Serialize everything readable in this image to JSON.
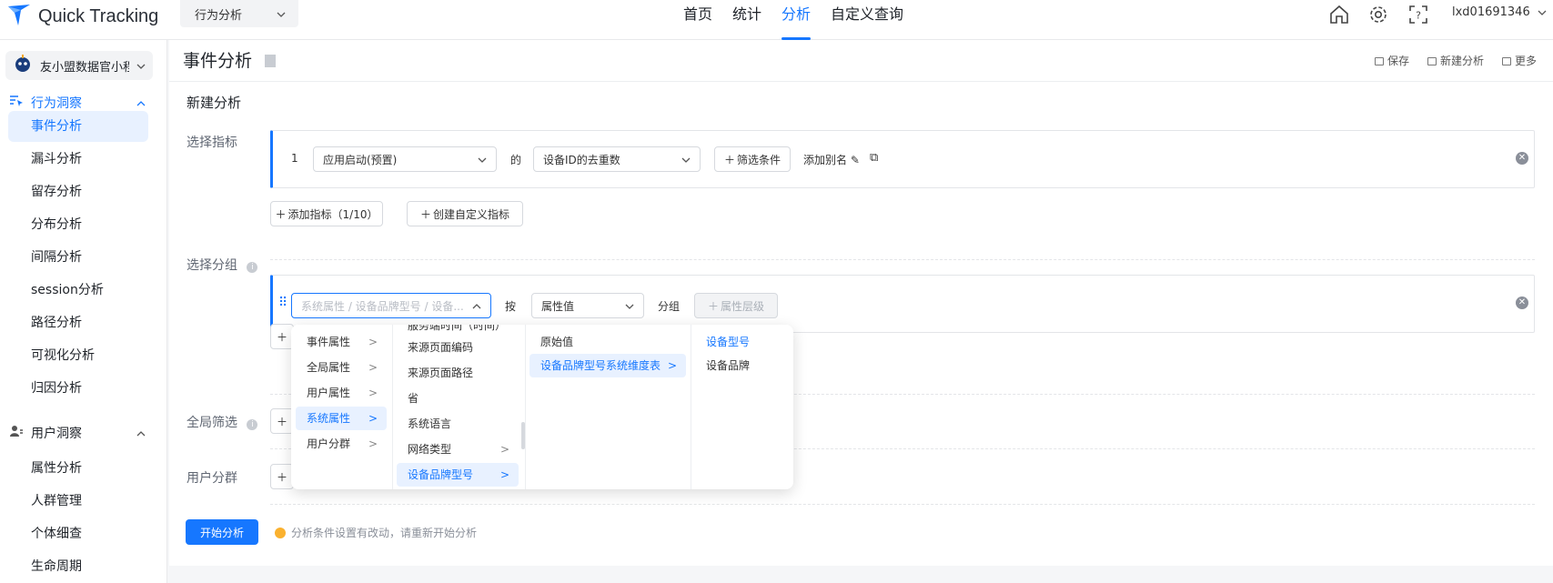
{
  "app": {
    "logo_text": "Quick Tracking",
    "module": "行为分析",
    "user": "lxd01691346",
    "brand_color": "#1677ff"
  },
  "nav": [
    {
      "label": "首页"
    },
    {
      "label": "统计"
    },
    {
      "label": "分析"
    },
    {
      "label": "自定义查询"
    }
  ],
  "sidebar": {
    "app_name": "友小盟数据官小程序",
    "group1": "行为洞察",
    "group1_items": [
      "事件分析",
      "漏斗分析",
      "留存分析",
      "分布分析",
      "间隔分析",
      "session分析",
      "路径分析",
      "可视化分析",
      "归因分析"
    ],
    "group2": "用户洞察",
    "group2_items": [
      "属性分析",
      "人群管理",
      "个体细查",
      "生命周期"
    ]
  },
  "page": {
    "title": "事件分析",
    "actions": [
      "保存",
      "新建分析",
      "更多"
    ],
    "section_title": "新建分析",
    "label_metric": "选择指标",
    "label_group": "选择分组",
    "label_filter": "全局筛选",
    "label_segment": "用户分群"
  },
  "metric": {
    "index": "1",
    "event": "应用启动(预置)",
    "of": "的",
    "measure": "设备ID的去重数",
    "filter_btn": "筛选条件",
    "alias": "添加别名",
    "add_metric": "添加指标（1/10）",
    "create_custom": "创建自定义指标"
  },
  "grouping": {
    "placeholder": "系统属性 / 设备品牌型号 / 设备...",
    "by": "按",
    "value_type": "属性值",
    "group_word": "分组",
    "level_btn": "属性层级"
  },
  "footer": {
    "start_btn": "开始分析",
    "warning": "分析条件设置有改动，请重新开始分析"
  },
  "dropdown": {
    "col1": [
      "事件属性",
      "全局属性",
      "用户属性",
      "系统属性",
      "用户分群"
    ],
    "col2_partial": "服务端时间（时间）",
    "col2": [
      "来源页面编码",
      "来源页面路径",
      "省",
      "系统语言",
      "网络类型",
      "设备品牌型号"
    ],
    "col3": [
      "原始值",
      "设备品牌型号系统维度表"
    ],
    "col4": [
      "设备型号",
      "设备品牌"
    ]
  }
}
